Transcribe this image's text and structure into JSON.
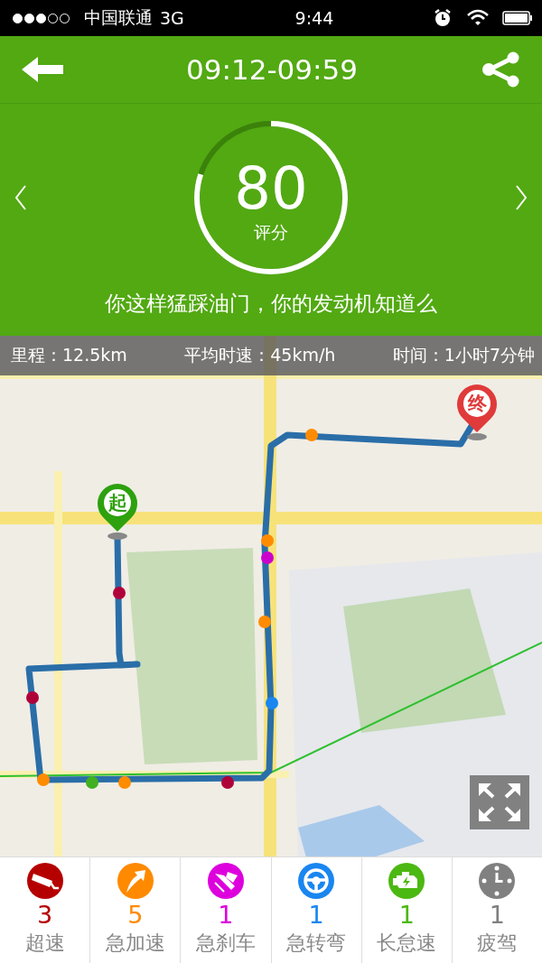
{
  "status_bar": {
    "carrier": "中国联通",
    "network": "3G",
    "time": "9:44"
  },
  "header": {
    "title": "09:12-09:59"
  },
  "score": {
    "value": "80",
    "label": "评分",
    "level": 0.8,
    "comment": "你这样猛踩油门，你的发动机知道么"
  },
  "stats": [
    "里程：12.5km",
    "平均时速：45km/h",
    "时间：1小时7分钟"
  ],
  "map": {
    "start_label": "起",
    "end_label": "终"
  },
  "events": [
    {
      "kind": "speeding",
      "color": "#b50000",
      "count": "3",
      "label": "超速"
    },
    {
      "kind": "acceleration",
      "color": "#ff8a00",
      "count": "5",
      "label": "急加速"
    },
    {
      "kind": "braking",
      "color": "#dd00dd",
      "count": "1",
      "label": "急刹车"
    },
    {
      "kind": "turning",
      "color": "#1a86f0",
      "count": "1",
      "label": "急转弯"
    },
    {
      "kind": "idling",
      "color": "#4cb812",
      "count": "1",
      "label": "长怠速"
    },
    {
      "kind": "fatigue",
      "color": "#808080",
      "count": "1",
      "label": "疲驾"
    }
  ]
}
